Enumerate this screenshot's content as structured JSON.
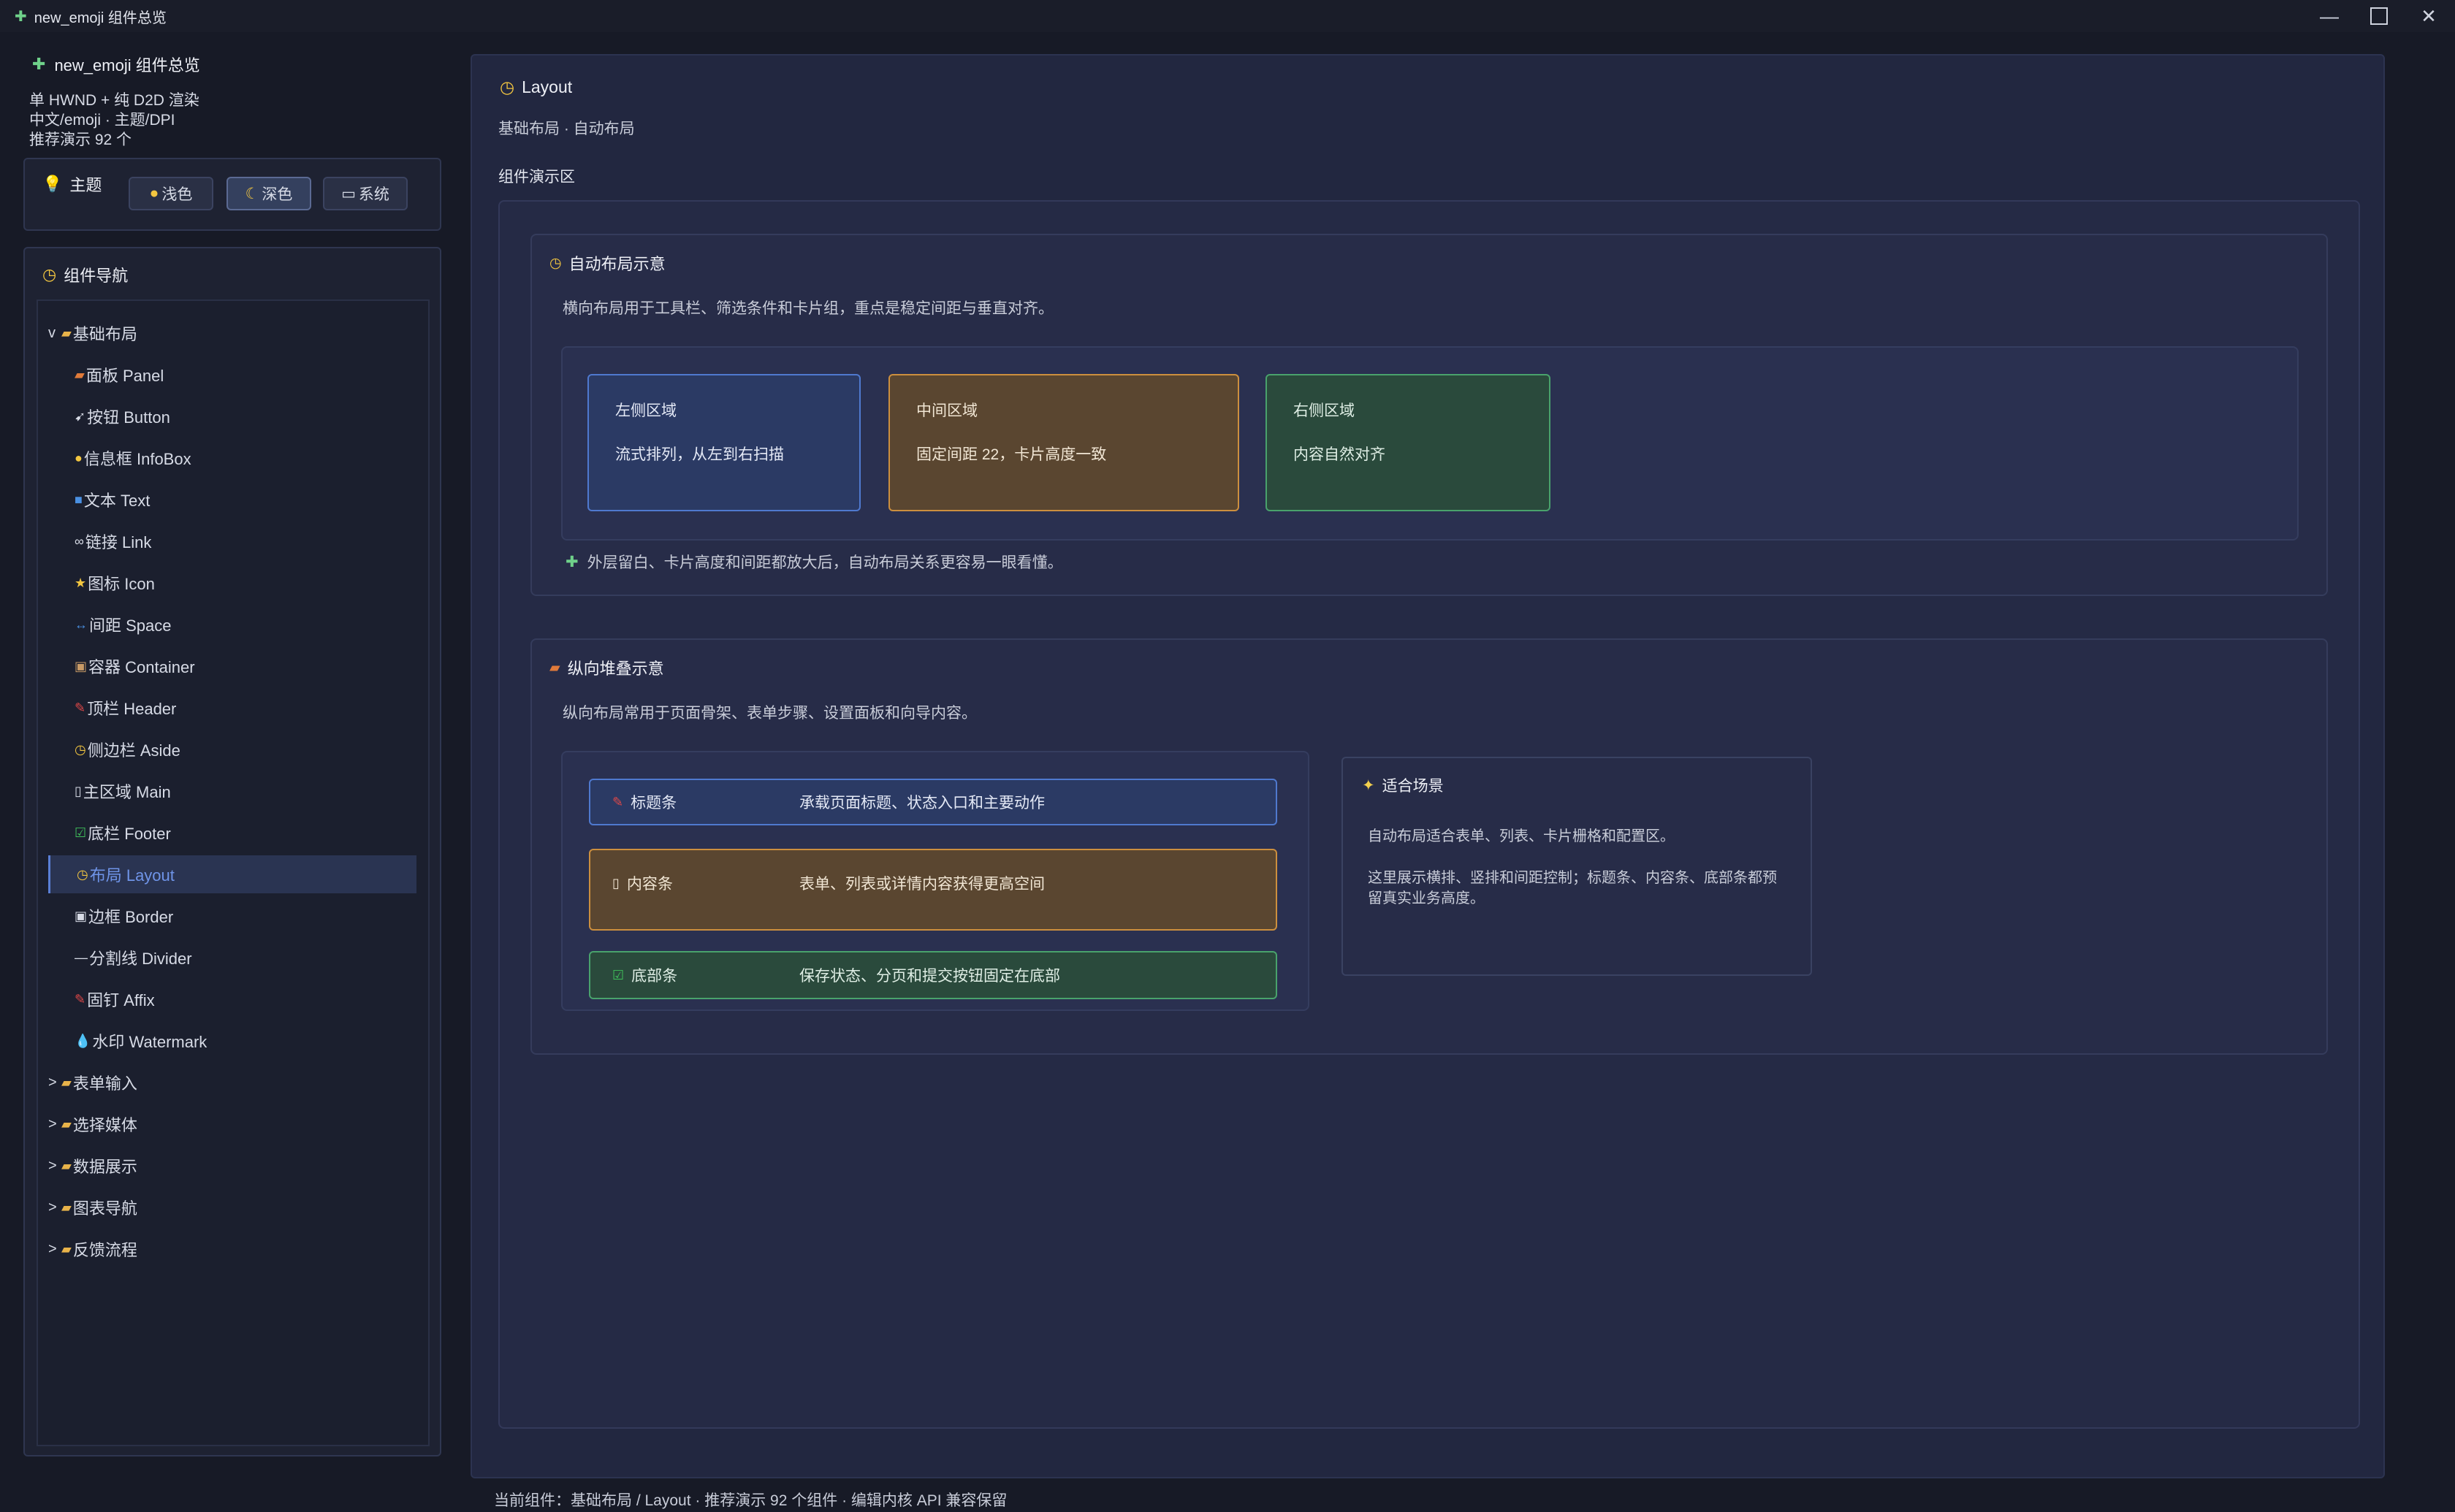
{
  "window": {
    "title": "new_emoji 组件总览",
    "app_icon": "puzzle-icon"
  },
  "sidebar": {
    "title": "new_emoji 组件总览",
    "info": [
      "单 HWND + 纯 D2D 渲染",
      "中文/emoji · 主题/DPI",
      "推荐演示 92 个"
    ],
    "theme": {
      "label": "主题",
      "buttons": [
        {
          "label": "浅色",
          "icon": "yellow-circle-icon"
        },
        {
          "label": "深色",
          "icon": "moon-icon",
          "active": true
        },
        {
          "label": "系统",
          "icon": "laptop-icon"
        }
      ]
    },
    "nav": {
      "header": "组件导航",
      "items": [
        {
          "prefix": "v",
          "icon": "folder-icon",
          "label": "基础布局",
          "group": true
        },
        {
          "icon": "panel-icon",
          "label": "面板 Panel"
        },
        {
          "icon": "rocket-icon",
          "label": "按钮 Button"
        },
        {
          "icon": "lightbulb-icon",
          "label": "信息框 InfoBox"
        },
        {
          "icon": "text-icon",
          "label": "文本 Text"
        },
        {
          "icon": "link-icon",
          "label": "链接 Link"
        },
        {
          "icon": "star-icon",
          "label": "图标 Icon"
        },
        {
          "icon": "arrows-icon",
          "label": "间距 Space"
        },
        {
          "icon": "package-icon",
          "label": "容器 Container"
        },
        {
          "icon": "pin-icon",
          "label": "顶栏 Header"
        },
        {
          "icon": "clock-icon",
          "label": "侧边栏 Aside"
        },
        {
          "icon": "page-icon",
          "label": "主区域 Main"
        },
        {
          "icon": "check-icon",
          "label": "底栏 Footer"
        },
        {
          "icon": "clock-icon",
          "label": "布局 Layout",
          "selected": true
        },
        {
          "icon": "border-icon",
          "label": "边框 Border"
        },
        {
          "icon": "dash-icon",
          "label": "分割线 Divider"
        },
        {
          "icon": "pin-icon",
          "label": "固钉 Affix"
        },
        {
          "icon": "droplet-icon",
          "label": "水印 Watermark"
        },
        {
          "prefix": ">",
          "icon": "folder-icon",
          "label": "表单输入",
          "group": true
        },
        {
          "prefix": ">",
          "icon": "folder-icon",
          "label": "选择媒体",
          "group": true
        },
        {
          "prefix": ">",
          "icon": "folder-icon",
          "label": "数据展示",
          "group": true
        },
        {
          "prefix": ">",
          "icon": "folder-icon",
          "label": "图表导航",
          "group": true
        },
        {
          "prefix": ">",
          "icon": "folder-icon",
          "label": "反馈流程",
          "group": true
        }
      ]
    }
  },
  "main": {
    "title": "Layout",
    "subtitle": "基础布局 · 自动布局",
    "demo_label": "组件演示区",
    "horizontal": {
      "title": "自动布局示意",
      "desc": "横向布局用于工具栏、筛选条件和卡片组，重点是稳定间距与垂直对齐。",
      "cards": [
        {
          "title": "左侧区域",
          "desc": "流式排列，从左到右扫描"
        },
        {
          "title": "中间区域",
          "desc": "固定间距 22，卡片高度一致"
        },
        {
          "title": "右侧区域",
          "desc": "内容自然对齐"
        }
      ],
      "note": "外层留白、卡片高度和间距都放大后，自动布局关系更容易一眼看懂。"
    },
    "vertical": {
      "title": "纵向堆叠示意",
      "desc": "纵向布局常用于页面骨架、表单步骤、设置面板和向导内容。",
      "rows": [
        {
          "label": "标题条",
          "icon": "pin-icon",
          "text": "承载页面标题、状态入口和主要动作"
        },
        {
          "label": "内容条",
          "icon": "page-icon",
          "text": "表单、列表或详情内容获得更高空间"
        },
        {
          "label": "底部条",
          "icon": "check-icon",
          "text": "保存状态、分页和提交按钮固定在底部"
        }
      ],
      "scene": {
        "title": "适合场景",
        "p1": "自动布局适合表单、列表、卡片栅格和配置区。",
        "p2": "这里展示横排、竖排和间距控制；标题条、内容条、底部条都预留真实业务高度。"
      }
    }
  },
  "statusbar": "当前组件：基础布局 / Layout · 推荐演示 92 个组件 · 编辑内核 API 兼容保留",
  "colors": {
    "background": "#171a26",
    "accent_blue": "#4f79cf",
    "accent_orange": "#cc8f3e",
    "accent_green": "#49a26c",
    "selected_text": "#6f94e8"
  }
}
